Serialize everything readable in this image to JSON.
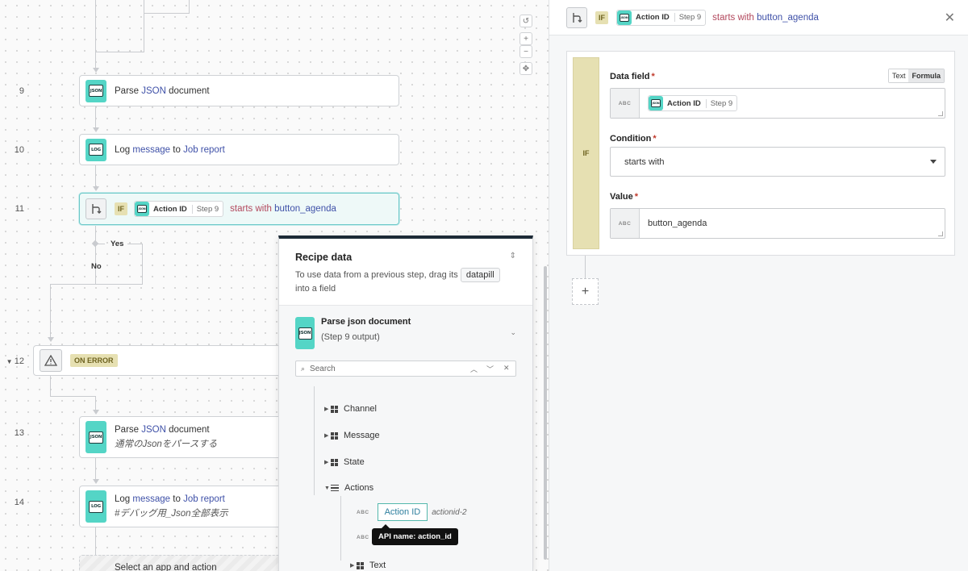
{
  "canvas": {
    "steps": [
      {
        "num": "9",
        "verb": "Parse",
        "hl1": "JSON",
        "rest": "document",
        "icon_text": "JSON"
      },
      {
        "num": "10",
        "verb": "Log",
        "hl1": "message",
        "mid": "to",
        "hl2": "Job report",
        "icon_text": "LOG"
      },
      {
        "num": "11"
      },
      {
        "num": "12"
      },
      {
        "num": "13",
        "verb": "Parse",
        "hl1": "JSON",
        "rest": "document",
        "sub": "通常のJsonをパースする",
        "icon_text": "JSON"
      },
      {
        "num": "14",
        "verb": "Log",
        "hl1": "message",
        "mid": "to",
        "hl2": "Job report",
        "sub": "#デバッグ用_Json全部表示",
        "icon_text": "LOG"
      }
    ],
    "if_step": {
      "badge": "IF",
      "pill_label": "Action ID",
      "pill_step": "Step 9",
      "condition": "starts with",
      "value": "button_agenda"
    },
    "branch_yes": "Yes",
    "branch_no": "No",
    "on_error": "ON ERROR",
    "ghost_text": "Select an app and action",
    "zoom": {
      "reset": "↺",
      "plus": "+",
      "minus": "−",
      "fit": "✥"
    }
  },
  "recipe": {
    "title": "Recipe data",
    "desc_before": "To use data from a previous step, drag its",
    "datapill": "datapill",
    "desc_after": "into a field",
    "source_title": "Parse json document",
    "source_sub": "(Step 9 output)",
    "search_placeholder": "Search",
    "tree": [
      "Channel",
      "Message",
      "State",
      "Actions"
    ],
    "action_id_pill": "Action ID",
    "action_id_note": "actionid-2",
    "tooltip": "API name: action_id",
    "text_node": "Text",
    "abc": "ABC"
  },
  "config": {
    "header": {
      "badge": "IF",
      "pill_label": "Action ID",
      "pill_step": "Step 9",
      "condition": "starts with",
      "value": "button_agenda"
    },
    "strip": "IF",
    "data_field_label": "Data field",
    "mode_text": "Text",
    "mode_formula": "Formula",
    "data_field_pill_label": "Action ID",
    "data_field_pill_step": "Step 9",
    "condition_label": "Condition",
    "condition_value": "starts with",
    "value_label": "Value",
    "value_value": "button_agenda",
    "abc": "ABC",
    "required": "*",
    "add": "+",
    "close": "✕"
  }
}
